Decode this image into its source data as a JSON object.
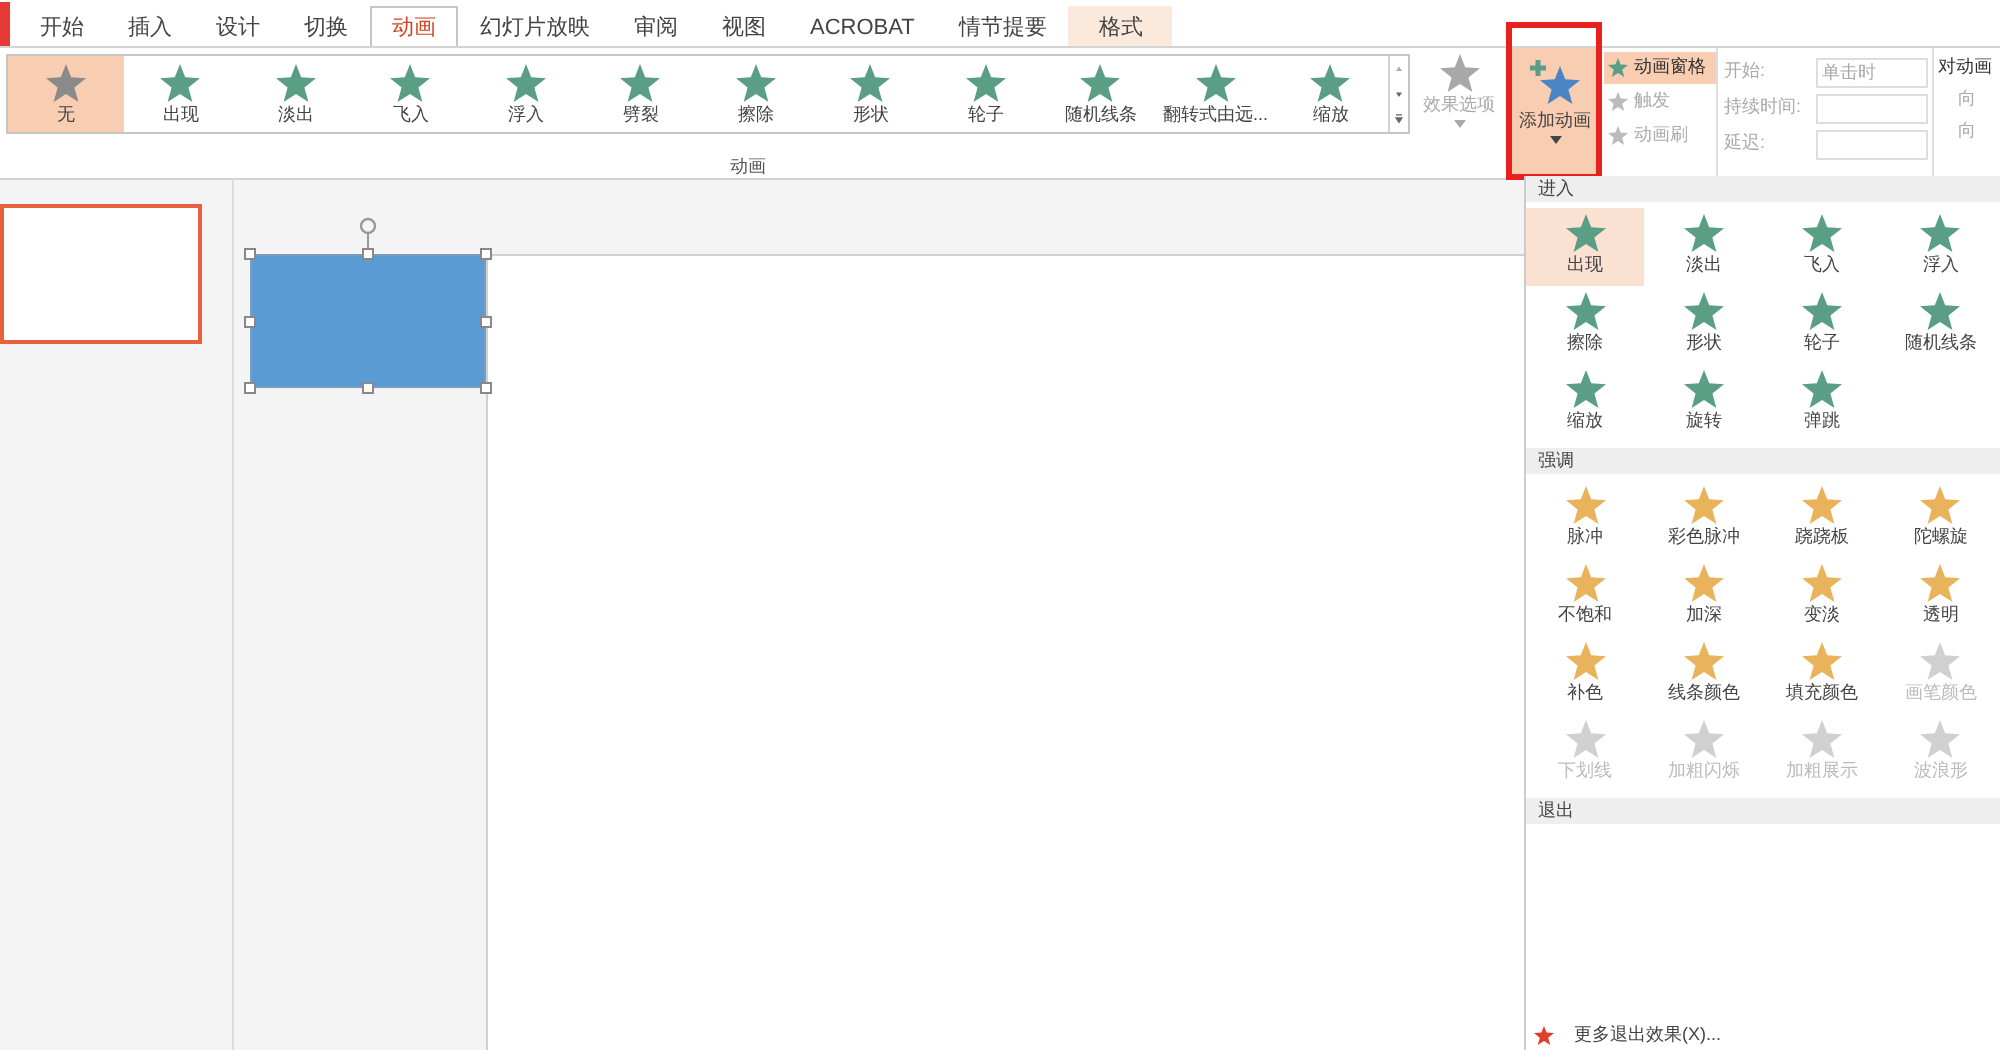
{
  "tabs": [
    {
      "label": "开始",
      "selected": false,
      "kind": "normal"
    },
    {
      "label": "插入",
      "selected": false,
      "kind": "normal"
    },
    {
      "label": "设计",
      "selected": false,
      "kind": "normal"
    },
    {
      "label": "切换",
      "selected": false,
      "kind": "normal"
    },
    {
      "label": "动画",
      "selected": true,
      "kind": "normal"
    },
    {
      "label": "幻灯片放映",
      "selected": false,
      "kind": "normal"
    },
    {
      "label": "审阅",
      "selected": false,
      "kind": "normal"
    },
    {
      "label": "视图",
      "selected": false,
      "kind": "normal"
    },
    {
      "label": "ACROBAT",
      "selected": false,
      "kind": "normal"
    },
    {
      "label": "情节提要",
      "selected": false,
      "kind": "normal"
    },
    {
      "label": "格式",
      "selected": false,
      "kind": "context"
    }
  ],
  "gallery": [
    {
      "label": "无",
      "selected": true,
      "kind": "none"
    },
    {
      "label": "出现",
      "selected": false,
      "kind": "enter"
    },
    {
      "label": "淡出",
      "selected": false,
      "kind": "enter"
    },
    {
      "label": "飞入",
      "selected": false,
      "kind": "enter"
    },
    {
      "label": "浮入",
      "selected": false,
      "kind": "enter"
    },
    {
      "label": "劈裂",
      "selected": false,
      "kind": "enter"
    },
    {
      "label": "擦除",
      "selected": false,
      "kind": "enter"
    },
    {
      "label": "形状",
      "selected": false,
      "kind": "enter"
    },
    {
      "label": "轮子",
      "selected": false,
      "kind": "enter"
    },
    {
      "label": "随机线条",
      "selected": false,
      "kind": "enter"
    },
    {
      "label": "翻转式由远...",
      "selected": false,
      "kind": "enter"
    },
    {
      "label": "缩放",
      "selected": false,
      "kind": "enter"
    }
  ],
  "effect_options": {
    "label": "效果选项",
    "disabled": true
  },
  "add_animation": {
    "label": "添加动画",
    "highlighted": true
  },
  "advanced": [
    {
      "label": "动画窗格",
      "selected": true,
      "disabled": false
    },
    {
      "label": "触发",
      "selected": false,
      "disabled": true
    },
    {
      "label": "动画刷",
      "selected": false,
      "disabled": true
    }
  ],
  "timing": [
    {
      "label": "开始:",
      "value": "单击时"
    },
    {
      "label": "持续时间:"
    },
    {
      "label": "延迟:"
    }
  ],
  "reorder": {
    "title": "对动画",
    "buttons": [
      "向",
      "向"
    ]
  },
  "group_label": "动画",
  "panel": {
    "sections": [
      {
        "title": "进入",
        "items": [
          {
            "label": "出现",
            "selected": true,
            "kind": "enter",
            "disabled": false
          },
          {
            "label": "淡出",
            "selected": false,
            "kind": "enter",
            "disabled": false
          },
          {
            "label": "飞入",
            "selected": false,
            "kind": "enter",
            "disabled": false
          },
          {
            "label": "浮入",
            "selected": false,
            "kind": "enter",
            "disabled": false
          },
          {
            "label": "擦除",
            "selected": false,
            "kind": "enter",
            "disabled": false
          },
          {
            "label": "形状",
            "selected": false,
            "kind": "enter",
            "disabled": false
          },
          {
            "label": "轮子",
            "selected": false,
            "kind": "enter",
            "disabled": false
          },
          {
            "label": "随机线条",
            "selected": false,
            "kind": "enter",
            "disabled": false
          },
          {
            "label": "缩放",
            "selected": false,
            "kind": "enter",
            "disabled": false
          },
          {
            "label": "旋转",
            "selected": false,
            "kind": "enter",
            "disabled": false
          },
          {
            "label": "弹跳",
            "selected": false,
            "kind": "enter",
            "disabled": false
          }
        ]
      },
      {
        "title": "强调",
        "items": [
          {
            "label": "脉冲",
            "selected": false,
            "kind": "emphasis",
            "disabled": false
          },
          {
            "label": "彩色脉冲",
            "selected": false,
            "kind": "emphasis",
            "disabled": false
          },
          {
            "label": "跷跷板",
            "selected": false,
            "kind": "emphasis",
            "disabled": false
          },
          {
            "label": "陀螺旋",
            "selected": false,
            "kind": "emphasis",
            "disabled": false
          },
          {
            "label": "不饱和",
            "selected": false,
            "kind": "emphasis",
            "disabled": false
          },
          {
            "label": "加深",
            "selected": false,
            "kind": "emphasis",
            "disabled": false
          },
          {
            "label": "变淡",
            "selected": false,
            "kind": "emphasis",
            "disabled": false
          },
          {
            "label": "透明",
            "selected": false,
            "kind": "emphasis",
            "disabled": false
          },
          {
            "label": "补色",
            "selected": false,
            "kind": "emphasis",
            "disabled": false
          },
          {
            "label": "线条颜色",
            "selected": false,
            "kind": "emphasis",
            "disabled": false
          },
          {
            "label": "填充颜色",
            "selected": false,
            "kind": "emphasis",
            "disabled": false
          },
          {
            "label": "画笔颜色",
            "selected": false,
            "kind": "emphasis",
            "disabled": true
          },
          {
            "label": "下划线",
            "selected": false,
            "kind": "emphasis",
            "disabled": true
          },
          {
            "label": "加粗闪烁",
            "selected": false,
            "kind": "emphasis",
            "disabled": true
          },
          {
            "label": "加粗展示",
            "selected": false,
            "kind": "emphasis",
            "disabled": true
          },
          {
            "label": "波浪形",
            "selected": false,
            "kind": "emphasis",
            "disabled": true
          }
        ]
      },
      {
        "title": "退出"
      }
    ],
    "footer": "更多退出效果(X)..."
  }
}
